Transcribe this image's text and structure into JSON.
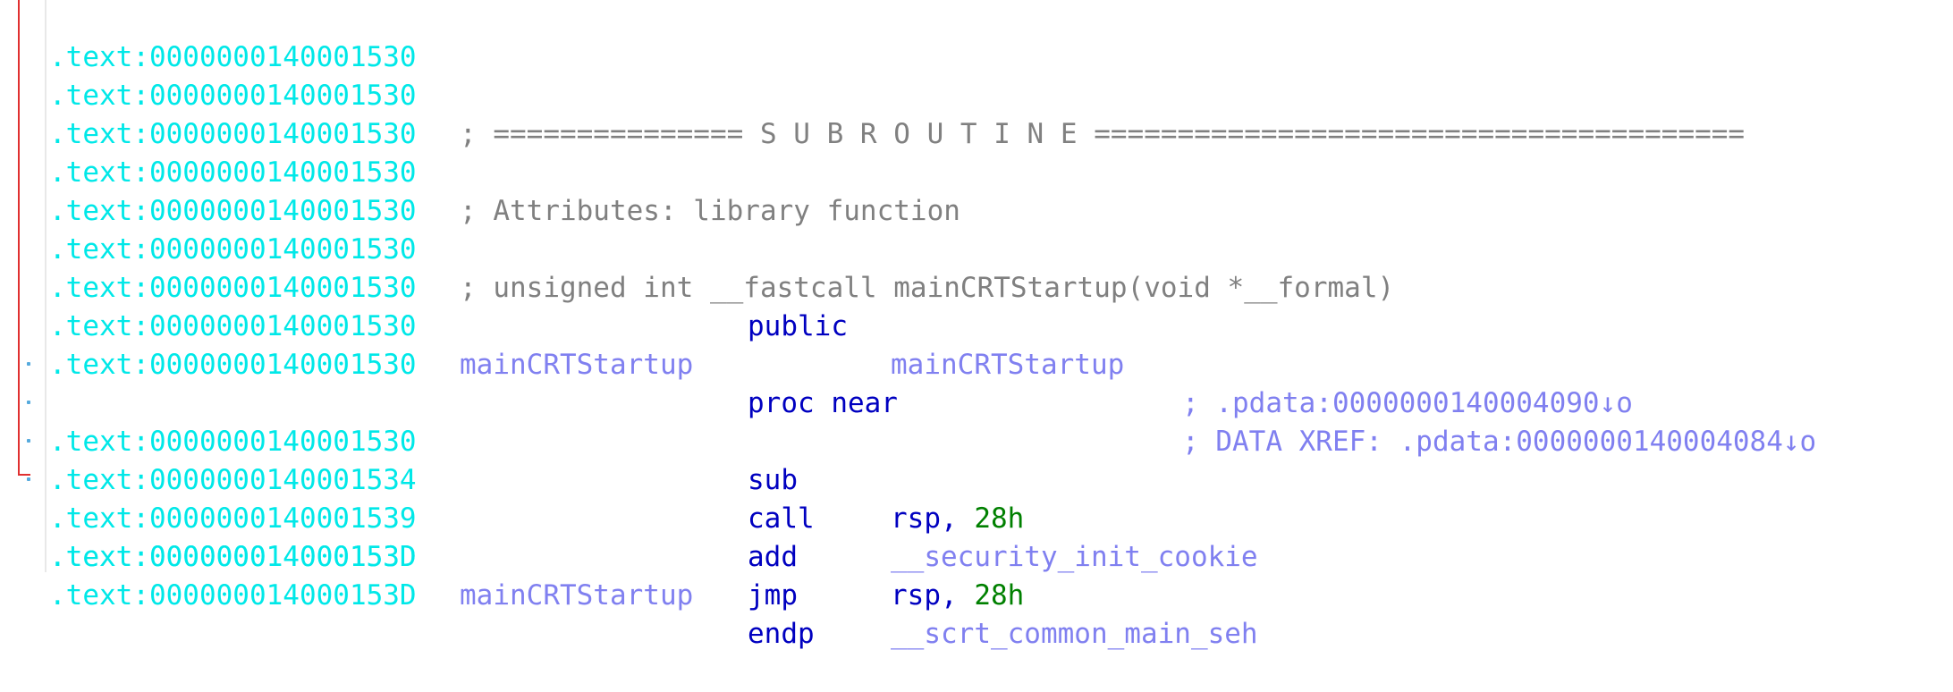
{
  "lines": [
    {
      "addr": ".text:0000000140001530"
    },
    {
      "addr": ".text:0000000140001530",
      "comment": "; =============== S U B R O U T I N E ======================================="
    },
    {
      "addr": ".text:0000000140001530"
    },
    {
      "addr": ".text:0000000140001530",
      "comment": "; Attributes: library function"
    },
    {
      "addr": ".text:0000000140001530"
    },
    {
      "addr": ".text:0000000140001530",
      "comment": "; unsigned int __fastcall mainCRTStartup(void *__formal)"
    },
    {
      "addr": ".text:0000000140001530",
      "mnemonic": "public",
      "operand": "mainCRTStartup"
    },
    {
      "addr": ".text:0000000140001530",
      "label": "mainCRTStartup",
      "mnemonic": "proc near",
      "xref": "; DATA XREF: .pdata:0000000140004084↓o"
    },
    {
      "addr": ".text:0000000140001530",
      "xref": "; .pdata:0000000140004090↓o"
    },
    {
      "addr": ".text:0000000140001530",
      "mnemonic": "sub",
      "operand_reg": "rsp, ",
      "operand_num": "28h"
    },
    {
      "addr": ".text:0000000140001534",
      "mnemonic": "call",
      "operand": "__security_init_cookie"
    },
    {
      "addr": ".text:0000000140001539",
      "mnemonic": "add",
      "operand_reg": "rsp, ",
      "operand_num": "28h"
    },
    {
      "addr": ".text:000000014000153D",
      "mnemonic": "jmp",
      "operand": "__scrt_common_main_seh"
    },
    {
      "addr": ".text:000000014000153D",
      "label": "mainCRTStartup",
      "mnemonic": "endp"
    },
    {
      "addr": ".text:000000014000153D"
    }
  ]
}
